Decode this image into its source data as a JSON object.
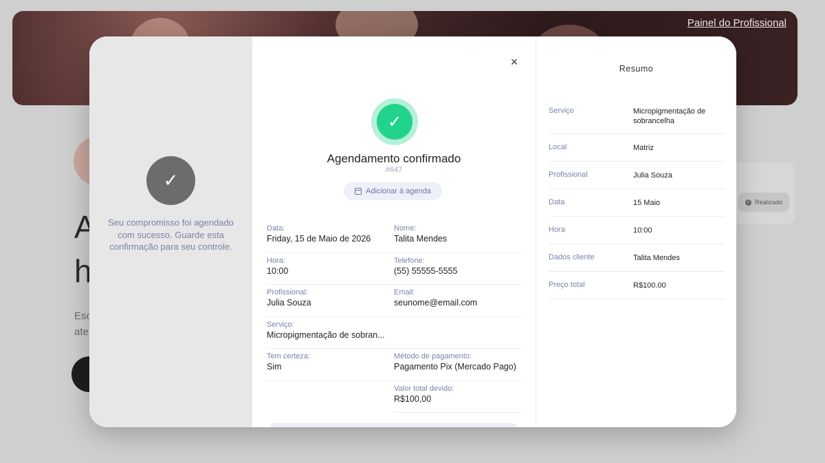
{
  "background": {
    "pro_link": "Painel do Profissional",
    "heading_lines": [
      "A",
      "h"
    ],
    "text_lines": [
      "Esc",
      "ate"
    ],
    "badge_label": "Realizado"
  },
  "modal": {
    "left": {
      "message": "Seu compromisso foi agendado com sucesso. Guarde esta confirmação para seu controle."
    },
    "center": {
      "title": "Agendamento confirmado",
      "id": "#647",
      "add_agenda_label": "Adicionar à agenda",
      "details": [
        [
          {
            "label": "Data:",
            "value": "Friday, 15 de Maio de 2026"
          },
          {
            "label": "Nome:",
            "value": "Talita Mendes"
          }
        ],
        [
          {
            "label": "Hora:",
            "value": "10:00"
          },
          {
            "label": "Telefone:",
            "value": "(55) 55555-5555"
          }
        ],
        [
          {
            "label": "Profissional:",
            "value": "Julia Souza"
          },
          {
            "label": "Email:",
            "value": "seunome@email.com"
          }
        ],
        [
          {
            "label": "Serviço:",
            "value": "Micropigmentação de sobran..."
          },
          {
            "label": "",
            "value": ""
          }
        ],
        [
          {
            "label": "Tem certeza:",
            "value": "Sim"
          },
          {
            "label": "Método de pagamento:",
            "value": "Pagamento Pix (Mercado Pago)"
          }
        ],
        [
          {
            "label": "",
            "value": ""
          },
          {
            "label": "Valor total devido:",
            "value": "R$100,00"
          }
        ]
      ]
    },
    "summary": {
      "title": "Resumo",
      "rows": [
        {
          "key": "Serviço",
          "value": "Micropigmentação de sobrancelha"
        },
        {
          "key": "Local",
          "value": "Matriz"
        },
        {
          "key": "Profissional",
          "value": "Julia Souza"
        },
        {
          "key": "Data",
          "value": "15 Maio"
        },
        {
          "key": "Hora",
          "value": "10:00"
        },
        {
          "key": "Dados cliente",
          "value": "Talita Mendes"
        },
        {
          "key": "Preço total",
          "value": "R$100.00"
        }
      ]
    }
  },
  "colors": {
    "success": "#22d38c",
    "success_ring": "#b5f0d9",
    "label_color": "#7a82a8",
    "left_pane": "#e7e7e7"
  }
}
